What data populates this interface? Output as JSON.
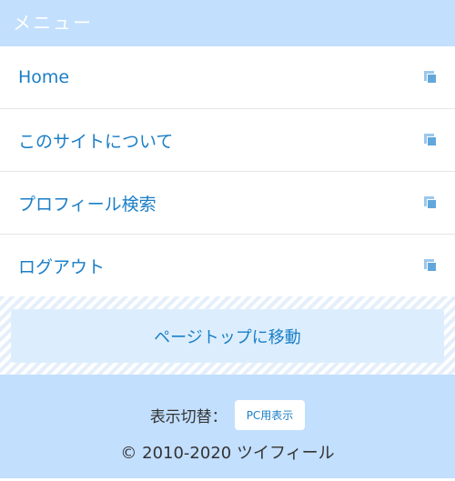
{
  "menu": {
    "title": "メニュー",
    "items": [
      {
        "label": "Home"
      },
      {
        "label": "このサイトについて"
      },
      {
        "label": "プロフィール検索"
      },
      {
        "label": "ログアウト"
      }
    ]
  },
  "pagetop": {
    "label": "ページトップに移動"
  },
  "footer": {
    "switch_label": "表示切替：",
    "pc_button": "PC用表示",
    "copyright": "© 2010-2020 ツイフィール"
  },
  "colors": {
    "header_bg": "#c2dffd",
    "link": "#1a7ec6",
    "pagetop_bg": "#dceefe"
  }
}
